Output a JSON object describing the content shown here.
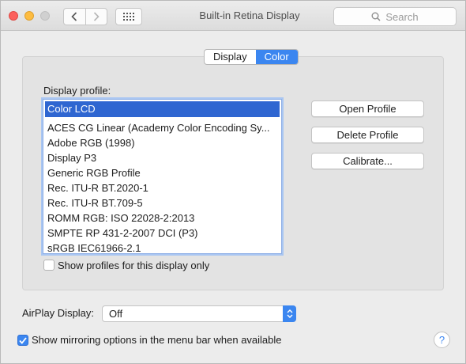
{
  "window": {
    "title": "Built-in Retina Display"
  },
  "toolbar": {
    "search_placeholder": "Search",
    "icons": [
      "back-icon",
      "forward-icon",
      "grid-icon",
      "search-icon"
    ]
  },
  "tabs": [
    {
      "label": "Display",
      "active": false
    },
    {
      "label": "Color",
      "active": true
    }
  ],
  "profile": {
    "label": "Display profile:",
    "selected": "Color LCD",
    "items": [
      "ACES CG Linear (Academy Color Encoding Sy...",
      "Adobe RGB (1998)",
      "Display P3",
      "Generic RGB Profile",
      "Rec. ITU-R BT.2020-1",
      "Rec. ITU-R BT.709-5",
      "ROMM RGB: ISO 22028-2:2013",
      "SMPTE RP 431-2-2007 DCI (P3)",
      "sRGB IEC61966-2.1"
    ],
    "buttons": {
      "open": "Open Profile",
      "delete": "Delete Profile",
      "calibrate": "Calibrate..."
    },
    "show_only_label": "Show profiles for this display only",
    "show_only_checked": false
  },
  "airplay": {
    "label": "AirPlay Display:",
    "value": "Off"
  },
  "mirroring": {
    "label": "Show mirroring options in the menu bar when available",
    "checked": true
  },
  "help": "?",
  "colors": {
    "accent": "#3b86f0",
    "selection": "#2f66d1"
  }
}
